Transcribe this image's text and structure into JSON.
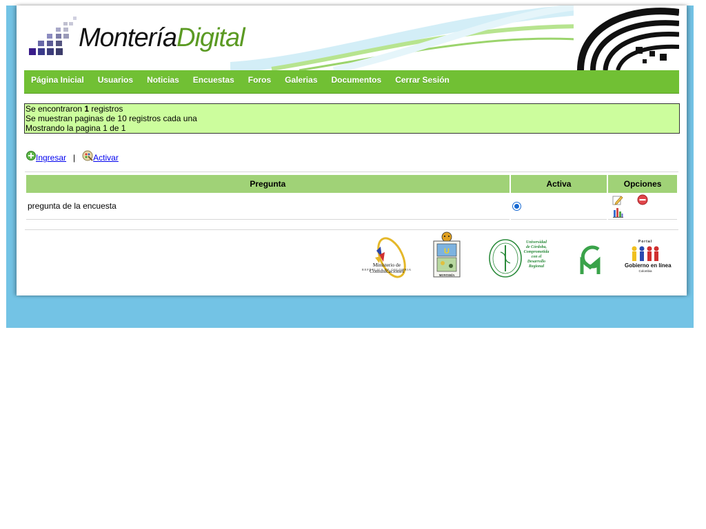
{
  "site": {
    "logo_part1": "Montería",
    "logo_part2": "Digital"
  },
  "nav": {
    "items": [
      "Página Inicial",
      "Usuarios",
      "Noticias",
      "Encuestas",
      "Foros",
      "Galerias",
      "Documentos",
      "Cerrar Sesión"
    ]
  },
  "info": {
    "line1_prefix": "Se encontraron ",
    "line1_count": "1",
    "line1_suffix": " registros",
    "line2": "Se muestran paginas de 10 registros cada una",
    "line3": "Mostrando la pagina 1 de 1"
  },
  "actions": {
    "add_label": "Ingresar",
    "separator": "|",
    "activate_label": "Activar"
  },
  "table": {
    "headers": [
      "Pregunta",
      "Activa",
      "Opciones"
    ],
    "rows": [
      {
        "question": "pregunta de la encuesta",
        "active": true
      }
    ]
  },
  "footer": {
    "ministerio": "Ministerio de Comunicaciones",
    "ministerio_sub": "REPÚBLICA DE COLOMBIA",
    "monteria": "MONTERÍA",
    "unicordoba_line1": "Universidad",
    "unicordoba_line2": "de Córdoba,",
    "unicordoba_line3": "Comprometida",
    "unicordoba_line4": "con el",
    "unicordoba_line5": "Desarrollo",
    "unicordoba_line6": "Regional",
    "gel_portal": "Portal",
    "gel_name": "Gobierno en línea",
    "gel_country": "Colombia"
  },
  "colors": {
    "frame": "#73c3e5",
    "nav": "#71c034",
    "info_bg": "#ccfd9d",
    "table_header": "#a0d277"
  }
}
